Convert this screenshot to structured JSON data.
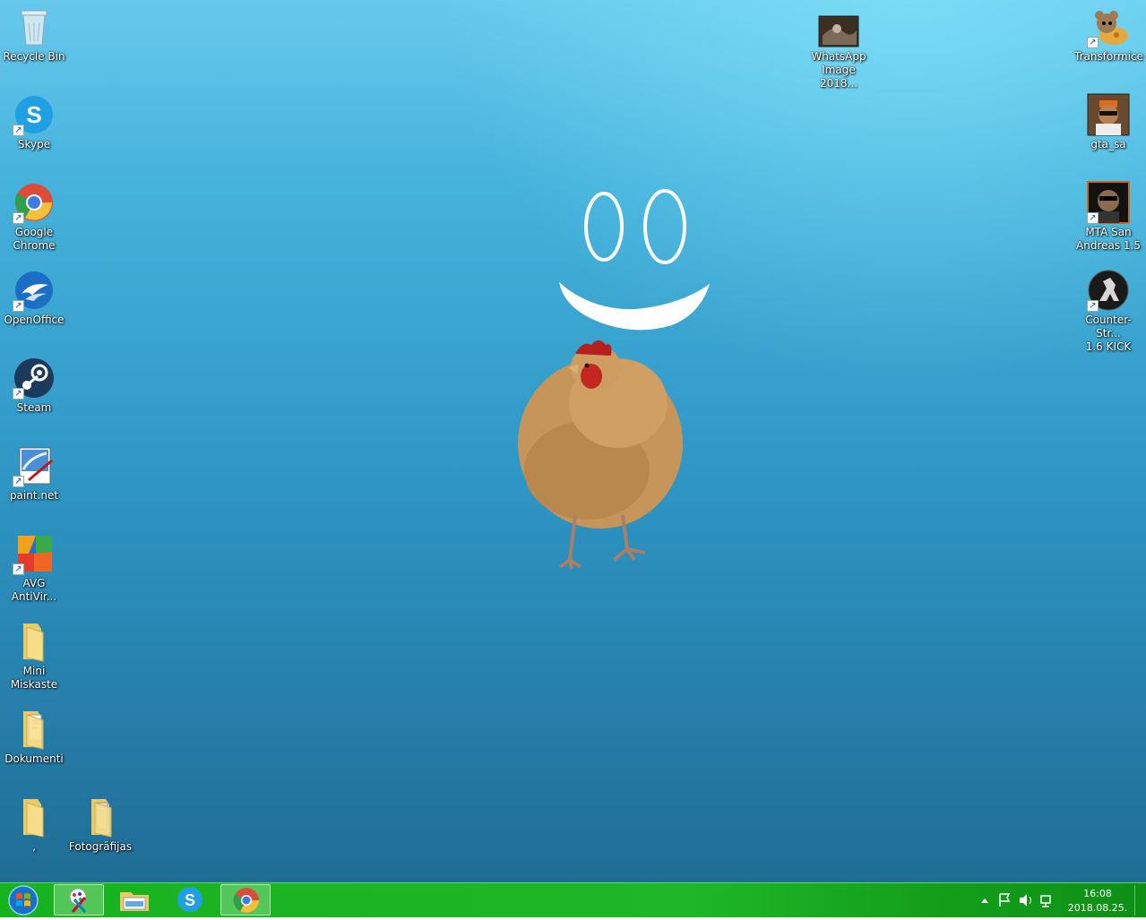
{
  "desktop": {
    "left_icons": [
      {
        "label": "Recycle Bin",
        "icon": "recycle-bin-icon"
      },
      {
        "label": "Skype",
        "icon": "skype-icon"
      },
      {
        "label": "Google\nChrome",
        "icon": "chrome-icon"
      },
      {
        "label": "OpenOffice",
        "icon": "openoffice-icon"
      },
      {
        "label": "Steam",
        "icon": "steam-icon"
      },
      {
        "label": "paint.net",
        "icon": "paintnet-icon"
      },
      {
        "label": "AVG\nAntiVir...",
        "icon": "avg-icon"
      },
      {
        "label": "Mini\nMiskaste",
        "icon": "folder-icon"
      },
      {
        "label": "Dokumenti",
        "icon": "documents-folder-icon"
      },
      {
        "label": ",",
        "icon": "folder-icon"
      },
      {
        "label": "Fotogrāfijas",
        "icon": "photos-folder-icon"
      }
    ],
    "right_icons": [
      {
        "label": "WhatsApp\nImage 2018...",
        "icon": "image-file-icon"
      },
      {
        "label": "Transformice",
        "icon": "transformice-icon"
      },
      {
        "label": "gta_sa",
        "icon": "gta-sa-icon"
      },
      {
        "label": "MTA San\nAndreas 1.5",
        "icon": "mta-icon"
      },
      {
        "label": "Counter-Str...\n1.6 KICK",
        "icon": "counter-strike-icon"
      }
    ]
  },
  "taskbar": {
    "pinned": [
      {
        "name": "paint-app",
        "icon": "paint-brush-icon",
        "active": false
      },
      {
        "name": "file-explorer",
        "icon": "explorer-icon",
        "active": false
      },
      {
        "name": "skype",
        "icon": "skype-icon",
        "active": false
      },
      {
        "name": "chrome",
        "icon": "chrome-icon",
        "active": true
      }
    ],
    "tray_icons": [
      "show-hidden-icons",
      "action-center-flag-icon",
      "volume-icon",
      "network-icon"
    ],
    "clock": {
      "time": "16:08",
      "date": "2018.08.25."
    }
  },
  "colors": {
    "taskbar": "#1fb729",
    "desktop_top": "#67c9ec",
    "desktop_bottom": "#1f6d95"
  }
}
